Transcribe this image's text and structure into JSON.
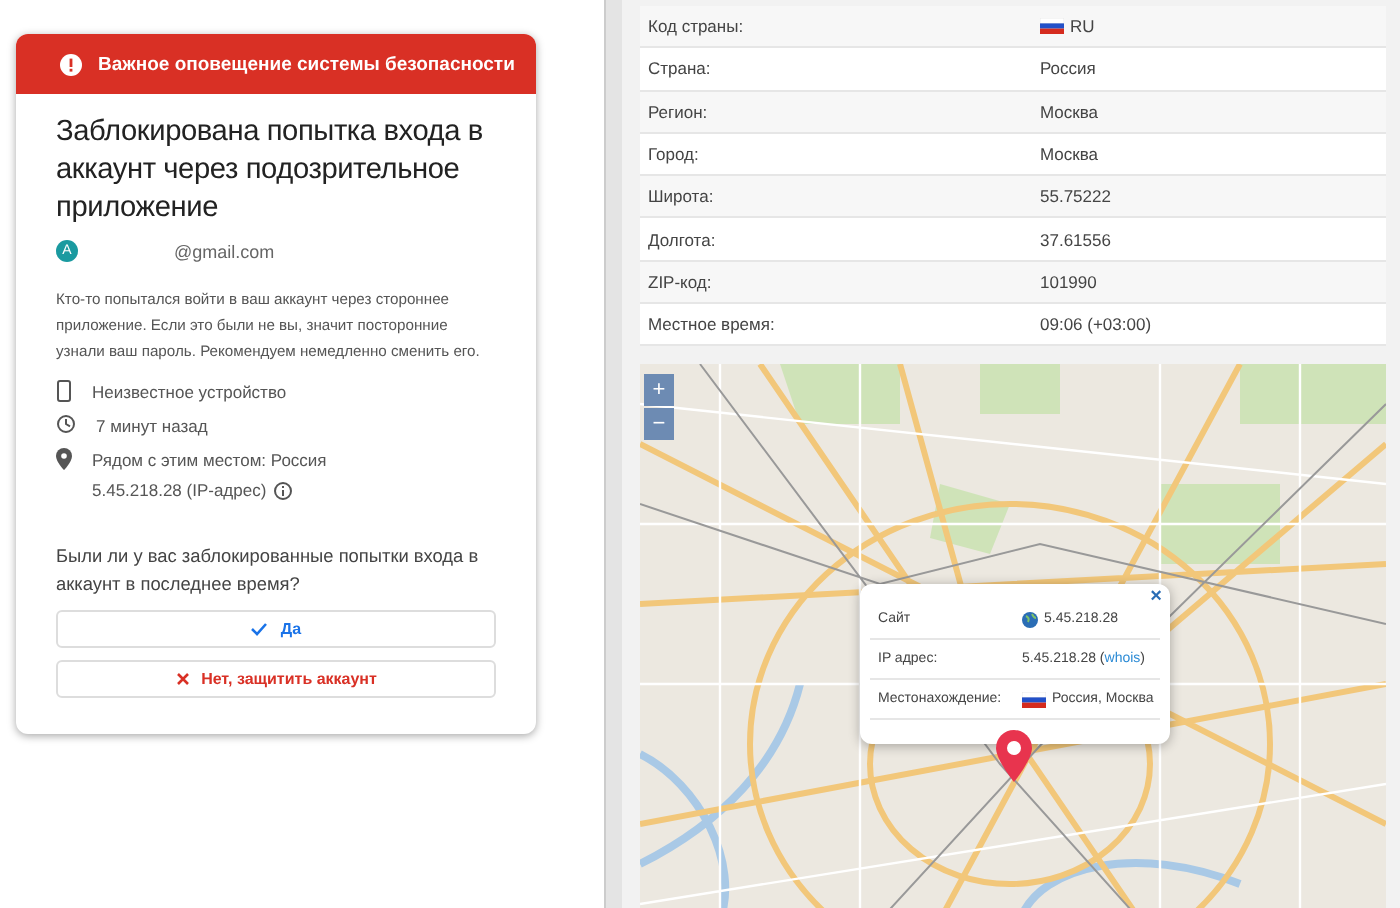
{
  "alert": {
    "header": "Важное оповещение системы безопасности",
    "title": "Заблокирована попытка входа в аккаунт через подозрительное приложение",
    "account": {
      "avatar_letter": "A",
      "email": "@gmail.com"
    },
    "message": "Кто-то попытался войти в ваш аккаунт через стороннее приложение. Если это были не вы, значит посторонние узнали ваш пароль. Рекомендуем немедленно сменить его.",
    "details": [
      {
        "kind": "device",
        "text": "Неизвестное устройство"
      },
      {
        "kind": "time",
        "text": "7 минут назад"
      },
      {
        "kind": "location",
        "text": "Рядом с этим местом: Россия",
        "subtext": "5.45.218.28 (IP-адрес)"
      }
    ],
    "question": "Были ли у вас заблокированные попытки входа в аккаунт в последнее время?",
    "buttons": [
      {
        "kind": "confirm",
        "label": "Да"
      },
      {
        "kind": "deny",
        "label": "Нет, защитить аккаунт"
      }
    ]
  },
  "info_table": {
    "rows": [
      {
        "label": "Код страны:",
        "value": "RU",
        "flag": true
      },
      {
        "label": "Страна:",
        "value": "Россия",
        "flag": false
      },
      {
        "label": "Регион:",
        "value": "Москва",
        "flag": false
      },
      {
        "label": "Город:",
        "value": "Москва",
        "flag": false
      },
      {
        "label": "Широта:",
        "value": "55.75222",
        "flag": false
      },
      {
        "label": "Долгота:",
        "value": "37.61556",
        "flag": false
      },
      {
        "label": "ZIP-код:",
        "value": "101990",
        "flag": false
      },
      {
        "label": "Местное время:",
        "value": "09:06 (+03:00)",
        "flag": false
      }
    ]
  },
  "map": {
    "zoom_in": "+",
    "zoom_out": "−",
    "popup": {
      "close": "×",
      "rows": [
        {
          "kind": "site",
          "label": "Сайт",
          "value": "5.45.218.28"
        },
        {
          "kind": "ip",
          "label": "IP адрес:",
          "value": "5.45.218.28 (",
          "link": "whois",
          "after": ")"
        },
        {
          "kind": "location",
          "label": "Местонахождение:",
          "value": "Россия, Москва"
        }
      ]
    }
  }
}
